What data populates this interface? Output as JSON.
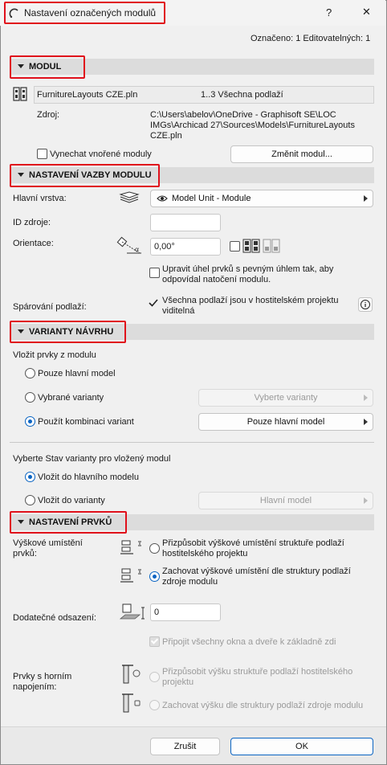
{
  "window": {
    "title": "Nastavení označených modulů",
    "help": "?",
    "close": "✕"
  },
  "selection_info": "Označeno: 1 Editovatelných: 1",
  "modul": {
    "header": "MODUL",
    "file_name": "FurnitureLayouts CZE.pln",
    "floors": "1..3 Všechna podlaží",
    "source_label": "Zdroj:",
    "source_path": "C:\\Users\\abelov\\OneDrive - Graphisoft SE\\LOC IMGs\\Archicad 27\\Sources\\Models\\FurnitureLayouts CZE.pln",
    "skip_nested_label": "Vynechat vnořené moduly",
    "change_button": "Změnit modul..."
  },
  "vazba": {
    "header": "NASTAVENÍ VAZBY MODULU",
    "main_layer_label": "Hlavní vrstva:",
    "main_layer_value": "Model Unit - Module",
    "source_id_label": "ID zdroje:",
    "source_id_value": "",
    "orientation_label": "Orientace:",
    "orientation_value": "0,00°",
    "adjust_angle_label": "Upravit úhel prvků s pevným úhlem tak, aby odpovídal natočení modulu.",
    "floor_match_label": "Spárování podlaží:",
    "floor_match_value": "Všechna podlaží jsou v hostitelském projektu viditelná"
  },
  "varianty": {
    "header": "VARIANTY NÁVRHU",
    "insert_label": "Vložit prvky z modulu",
    "opt_main_only": "Pouze hlavní model",
    "opt_selected": "Vybrané varianty",
    "select_variants_button": "Vyberte varianty",
    "opt_combination": "Použít kombinaci variant",
    "combination_value": "Pouze hlavní model",
    "state_label": "Vyberte Stav varianty pro vložený modul",
    "opt_to_main": "Vložit do hlavního modelu",
    "opt_to_variant": "Vložit do varianty",
    "variant_value": "Hlavní model"
  },
  "prvky": {
    "header": "NASTAVENÍ PRVKŮ",
    "height_label": "Výškové umístění prvků:",
    "height_opt1": "Přizpůsobit výškové umístění struktuře podlaží hostitelského projektu",
    "height_opt2": "Zachovat výškové umístění dle struktury podlaží zdroje modulu",
    "offset_label": "Dodatečné odsazení:",
    "offset_value": "0",
    "attach_label": "Připojit všechny okna a dveře k základně zdi",
    "top_link_label": "Prvky s horním napojením:",
    "top_opt1": "Přizpůsobit výšku struktuře podlaží hostitelského projektu",
    "top_opt2": "Zachovat výšku dle struktury podlaží zdroje modulu"
  },
  "footer": {
    "cancel": "Zrušit",
    "ok": "OK"
  }
}
